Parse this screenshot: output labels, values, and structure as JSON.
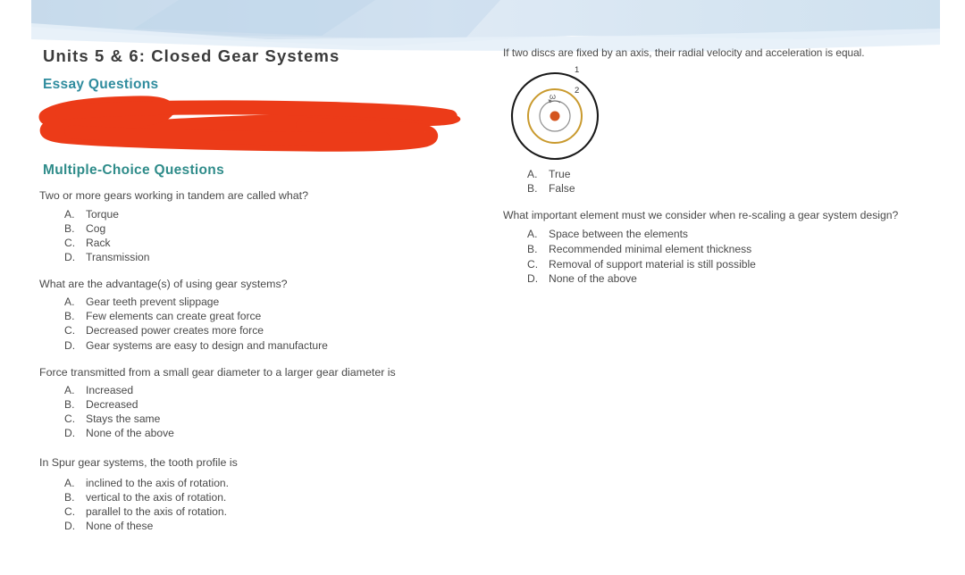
{
  "document": {
    "title": "Units 5 & 6: Closed Gear Systems",
    "essay_heading": "Essay Questions",
    "mcq_heading": "Multiple-Choice Questions"
  },
  "colors": {
    "heading_teal": "#2f8c9e",
    "banner_blue": "#d7e6f2",
    "redaction_red": "#ec3b18",
    "body_text": "#4a4a4a",
    "disc_outer_ring": "#1a1a1a",
    "disc_middle_ring": "#c99a2e",
    "disc_inner_ring": "#8a8a8a",
    "disc_hub": "#d4551f"
  },
  "annotations": {
    "redaction_label": "red-scribble-redaction"
  },
  "left_column": {
    "questions": [
      {
        "stem": "Two or more gears working in tandem are called what?",
        "choices": [
          {
            "letter": "A.",
            "text": "Torque"
          },
          {
            "letter": "B.",
            "text": "Cog"
          },
          {
            "letter": "C.",
            "text": "Rack"
          },
          {
            "letter": "D.",
            "text": "Transmission"
          }
        ]
      },
      {
        "stem": "What are the advantage(s) of using gear systems?",
        "choices": [
          {
            "letter": "A.",
            "text": "Gear teeth prevent slippage"
          },
          {
            "letter": "B.",
            "text": "Few elements can create great force"
          },
          {
            "letter": "C.",
            "text": "Decreased power creates more force"
          },
          {
            "letter": "D.",
            "text": "Gear systems are easy to design and manufacture"
          }
        ]
      },
      {
        "stem": "Force transmitted from a small gear diameter to a larger gear diameter is",
        "choices": [
          {
            "letter": "A.",
            "text": "Increased"
          },
          {
            "letter": "B.",
            "text": "Decreased"
          },
          {
            "letter": "C.",
            "text": "Stays the same"
          },
          {
            "letter": "D.",
            "text": "None of the above"
          }
        ]
      },
      {
        "stem": "In Spur gear systems, the tooth profile is",
        "choices": [
          {
            "letter": "A.",
            "text": "inclined to the axis of rotation."
          },
          {
            "letter": "B.",
            "text": "vertical to the axis of rotation."
          },
          {
            "letter": "C.",
            "text": "parallel to the axis of rotation."
          },
          {
            "letter": "D.",
            "text": "None of these"
          }
        ]
      }
    ]
  },
  "right_column": {
    "questions": [
      {
        "stem": "If two discs are fixed by an axis, their radial velocity and acceleration is equal.",
        "diagram": {
          "name": "concentric-discs-diagram",
          "label_outer": "1",
          "label_middle": "2",
          "label_omega": "ω"
        },
        "choices": [
          {
            "letter": "A.",
            "text": "True"
          },
          {
            "letter": "B.",
            "text": "False"
          }
        ]
      },
      {
        "stem": "What important element must we consider when re-scaling a gear system design?",
        "choices": [
          {
            "letter": "A.",
            "text": "Space between the elements"
          },
          {
            "letter": "B.",
            "text": "Recommended minimal element thickness"
          },
          {
            "letter": "C.",
            "text": "Removal of support material is still possible"
          },
          {
            "letter": "D.",
            "text": "None of the above"
          }
        ]
      }
    ]
  }
}
